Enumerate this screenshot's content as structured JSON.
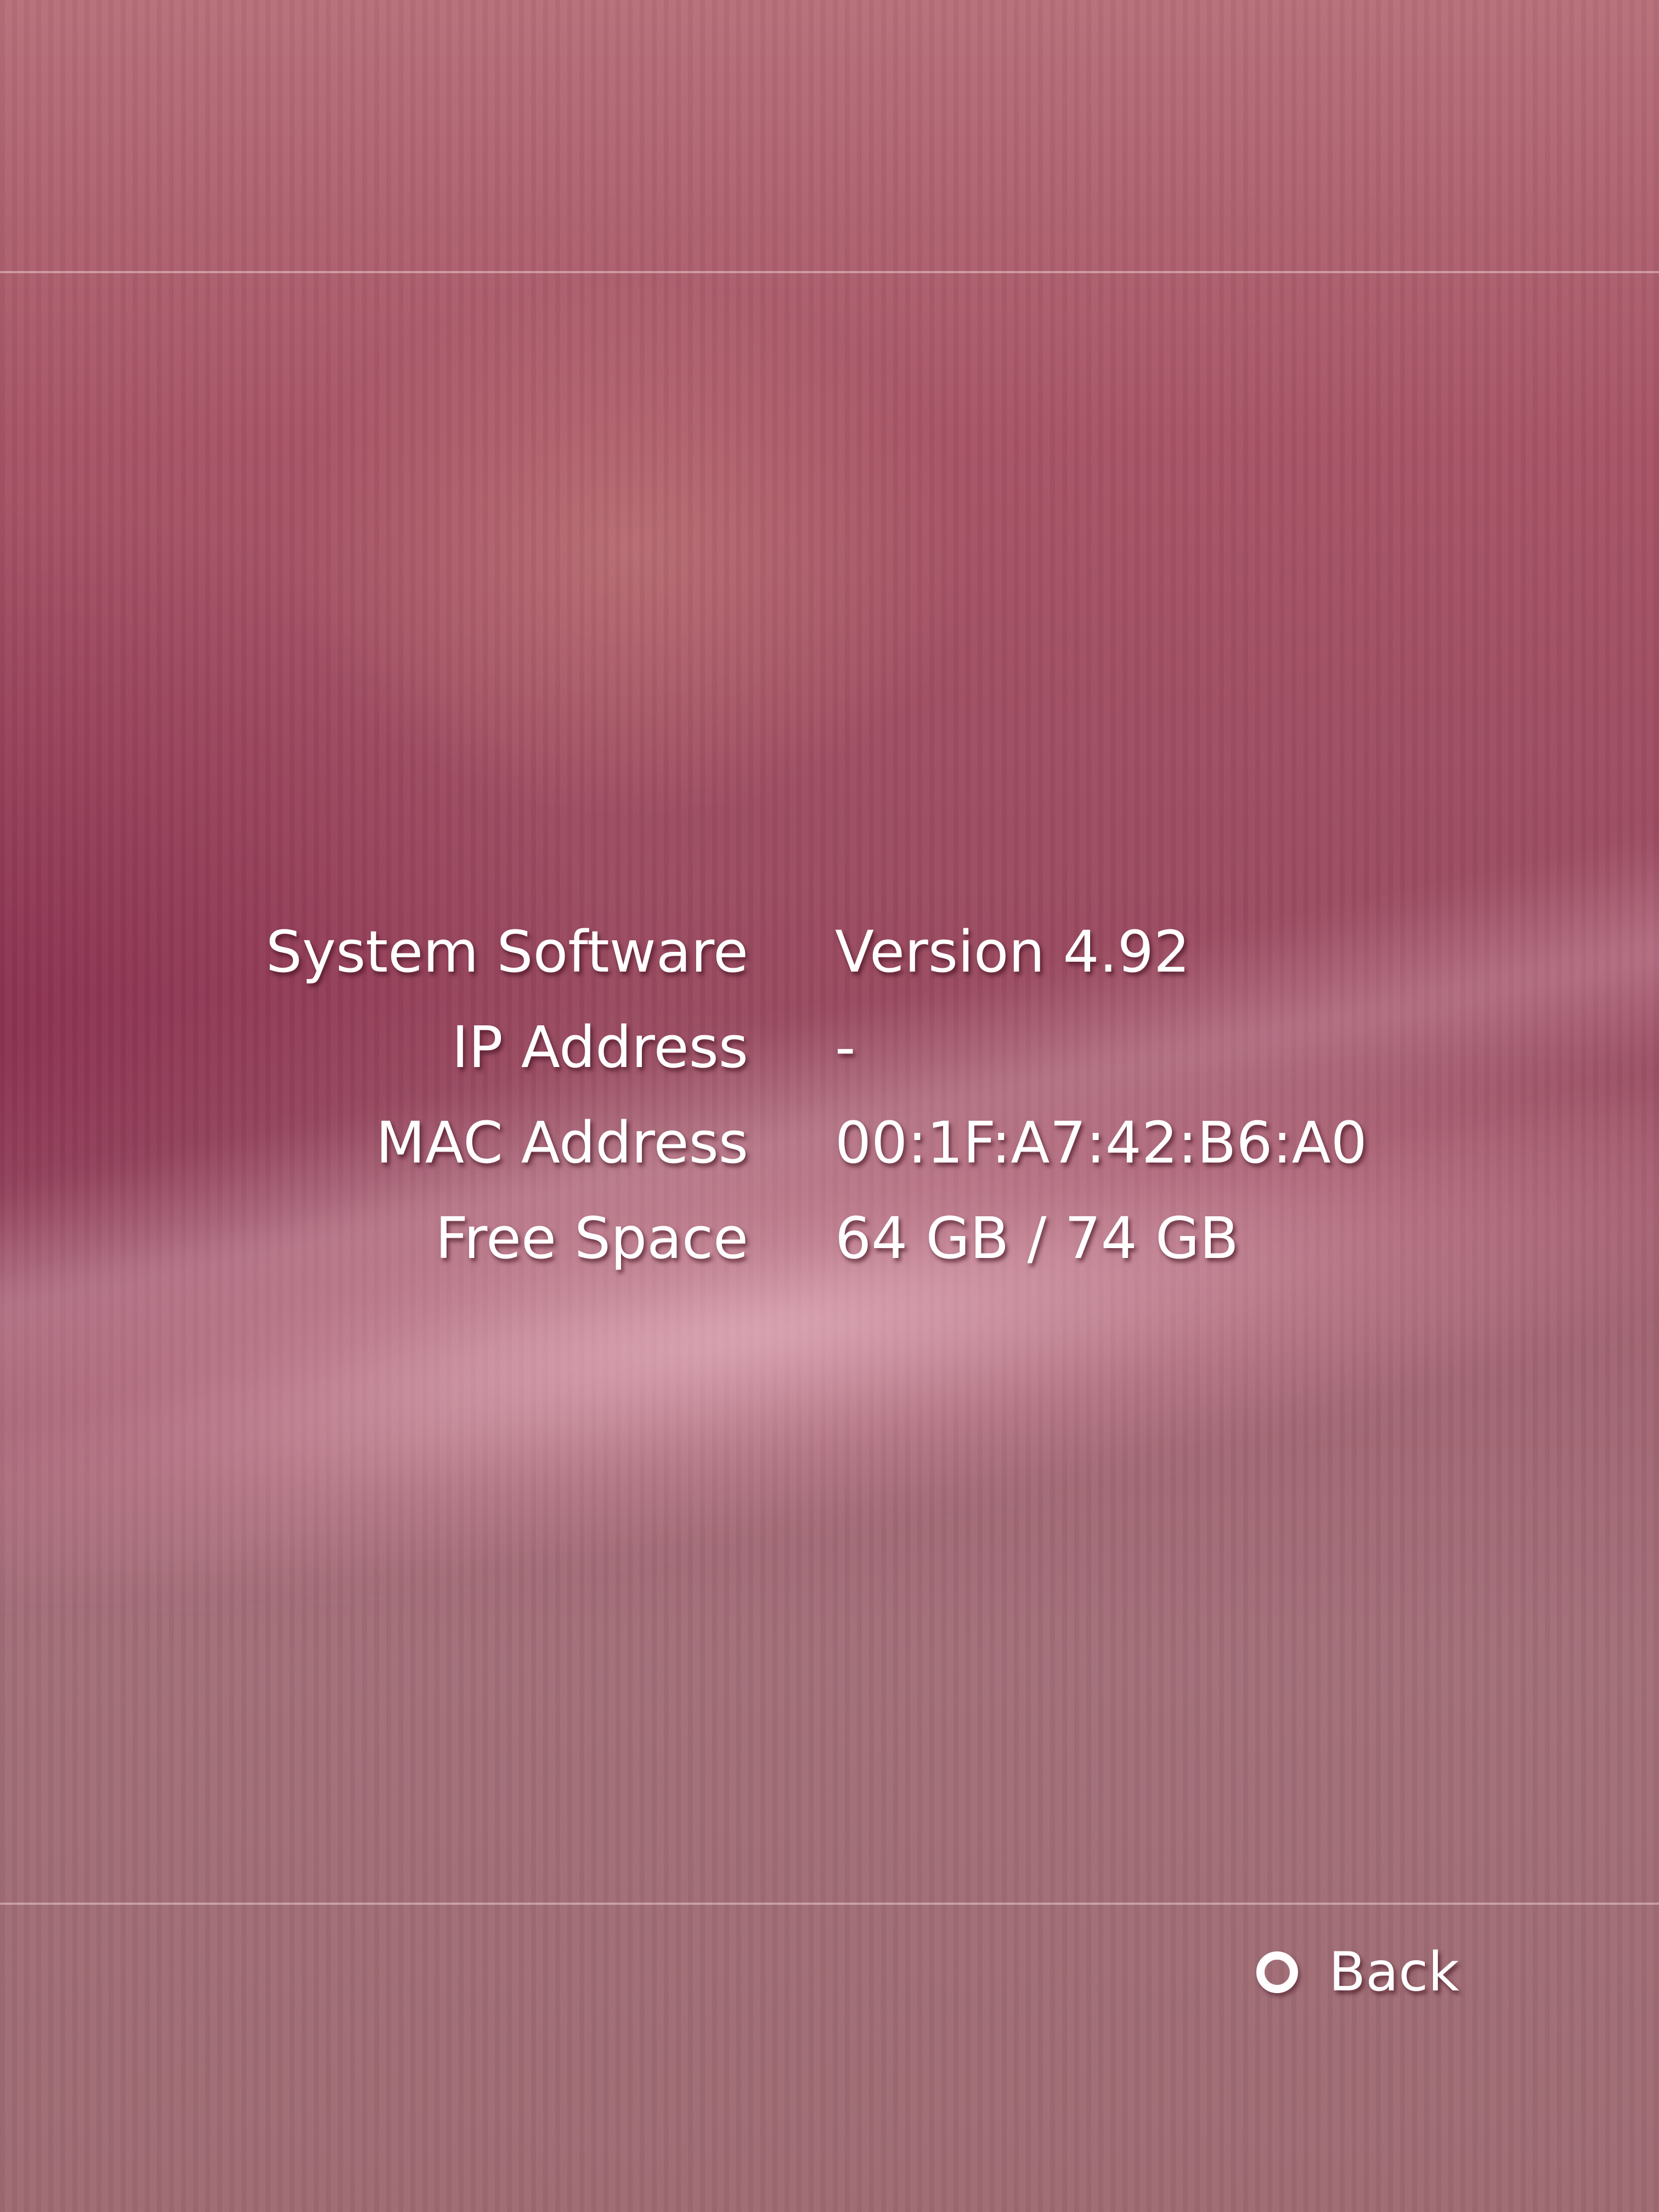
{
  "system_info": {
    "rows": [
      {
        "label": "System Software",
        "value": "Version 4.92"
      },
      {
        "label": "IP Address",
        "value": "-"
      },
      {
        "label": "MAC Address",
        "value": "00:1F:A7:42:B6:A0"
      },
      {
        "label": "Free Space",
        "value": "64 GB / 74 GB"
      }
    ]
  },
  "footer": {
    "back_label": "Back",
    "back_icon": "circle-button-icon"
  },
  "colors": {
    "background": "#a75466",
    "text": "#ffffff"
  }
}
